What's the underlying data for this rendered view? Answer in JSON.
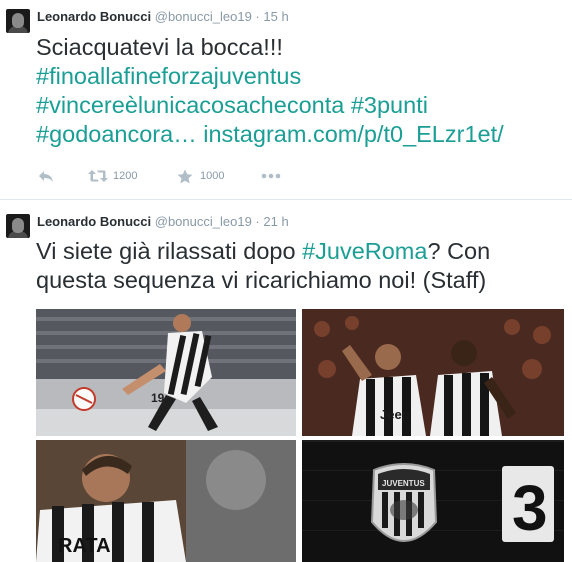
{
  "tweets": [
    {
      "name": "Leonardo Bonucci",
      "handle": "@bonucci_leo19",
      "time": "15 h",
      "text_plain": "Sciacquatevi la bocca!!!",
      "hashtags": [
        "#finoallafineforzajuventus",
        "#vincereèlunicacosacheconta",
        "#3punti",
        "#godoancora…"
      ],
      "link": "instagram.com/p/t0_ELzr1et/",
      "retweets": "1200",
      "favorites": "1000"
    },
    {
      "name": "Leonardo Bonucci",
      "handle": "@bonucci_leo19",
      "time": "21 h",
      "text_pre": "Vi siete già rilassati dopo ",
      "hashtag": "#JuveRoma",
      "text_post": "? Con questa sequenza vi ricarichiamo noi! (Staff)"
    }
  ],
  "separator": "·",
  "icons": {
    "reply": "reply-arrow-icon",
    "retweet": "retweet-icon",
    "favorite": "star-icon",
    "more": "more-dots-icon"
  },
  "photo_text": {
    "jersey_number": "19",
    "sponsor": "Jeep",
    "back_name": "RATA",
    "crest_text": "JUVENTUS",
    "scoreboard_digit": "3"
  },
  "colors": {
    "link": "#1a9e95",
    "text": "#292f33",
    "muted": "#8899a6",
    "divider": "#e1e8ed"
  }
}
